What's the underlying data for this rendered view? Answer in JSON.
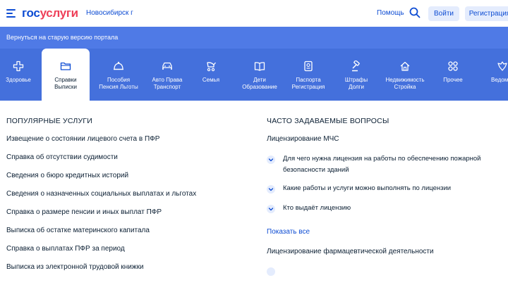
{
  "header": {
    "logo_part1": "гос",
    "logo_part2": "услуги",
    "city": "Новосибирск г",
    "help": "Помощь",
    "login": "Войти",
    "register": "Регистрация"
  },
  "banner": {
    "link": "Вернуться на старую версию портала"
  },
  "categories": [
    {
      "label": "Здоровье",
      "icon": "health-cross-icon"
    },
    {
      "label": "Справки\nВыписки",
      "icon": "folder-icon",
      "active": true
    },
    {
      "label": "Пособия\nПенсия Льготы",
      "icon": "wallet-icon"
    },
    {
      "label": "Авто Права\nТранспорт",
      "icon": "car-icon"
    },
    {
      "label": "Семья",
      "icon": "stroller-icon"
    },
    {
      "label": "Дети\nОбразование",
      "icon": "book-icon"
    },
    {
      "label": "Паспорта\nРегистрация",
      "icon": "passport-icon"
    },
    {
      "label": "Штрафы\nДолги",
      "icon": "gavel-icon"
    },
    {
      "label": "Недвижимость\nСтройка",
      "icon": "house-icon"
    },
    {
      "label": "Прочее",
      "icon": "grid-icon"
    },
    {
      "label": "Ведомства",
      "icon": "emblem-icon"
    }
  ],
  "popular": {
    "title": "ПОПУЛЯРНЫЕ УСЛУГИ",
    "items": [
      "Извещение о состоянии лицевого счета в ПФР",
      "Справка об отсутствии судимости",
      "Сведения о бюро кредитных историй",
      "Сведения о назначенных социальных выплатах и льготах",
      "Справка о размере пенсии и иных выплат ПФР",
      "Выписка об остатке материнского капитала",
      "Справка о выплатах ПФР за период",
      "Выписка из электронной трудовой книжки"
    ]
  },
  "faq": {
    "title": "ЧАСТО ЗАДАВАЕМЫЕ ВОПРОСЫ",
    "group1": "Лицензирование МЧС",
    "questions": [
      "Для чего нужна лицензия на работы по обеспечению пожарной безопасности зданий",
      "Какие работы и услуги можно выполнять по лицензии",
      "Кто выдаёт лицензию"
    ],
    "show_all": "Показать все",
    "group2": "Лицензирование фармацевтической деятельности"
  },
  "colors": {
    "brand_blue": "#0d4cd3",
    "brand_red": "#ee3f58",
    "nav_bg": "#4470dc",
    "banner_bg": "#4f7ae6"
  }
}
